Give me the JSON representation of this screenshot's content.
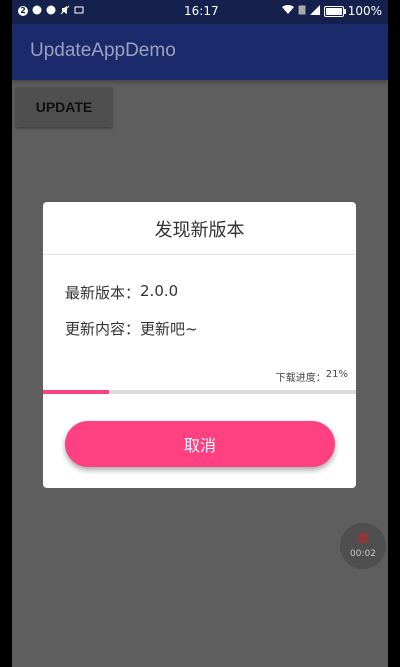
{
  "status_bar": {
    "notification_badge": "2",
    "time": "16:17",
    "battery": "100%"
  },
  "app_bar": {
    "title": "UpdateAppDemo"
  },
  "main": {
    "update_button_label": "UPDATE"
  },
  "dialog": {
    "title": "发现新版本",
    "version_label": "最新版本：",
    "version_value": "2.0.0",
    "content_label": "更新内容：",
    "content_value": "更新吧~",
    "progress_label": "下载进度：",
    "progress_percent_text": "21%",
    "progress_fraction": 0.21,
    "cancel_label": "取消",
    "accent_color": "#ff4081"
  },
  "recorder": {
    "time": "00:02"
  },
  "colors": {
    "status_bar": "#15204c",
    "app_bar": "#1b2a6b",
    "accent": "#ff4081"
  },
  "icons": [
    "badge-icon",
    "notification-icon",
    "notification-icon",
    "mute-icon",
    "cast-icon",
    "wifi-icon",
    "sim-icon",
    "signal-icon",
    "battery-icon",
    "record-icon"
  ]
}
